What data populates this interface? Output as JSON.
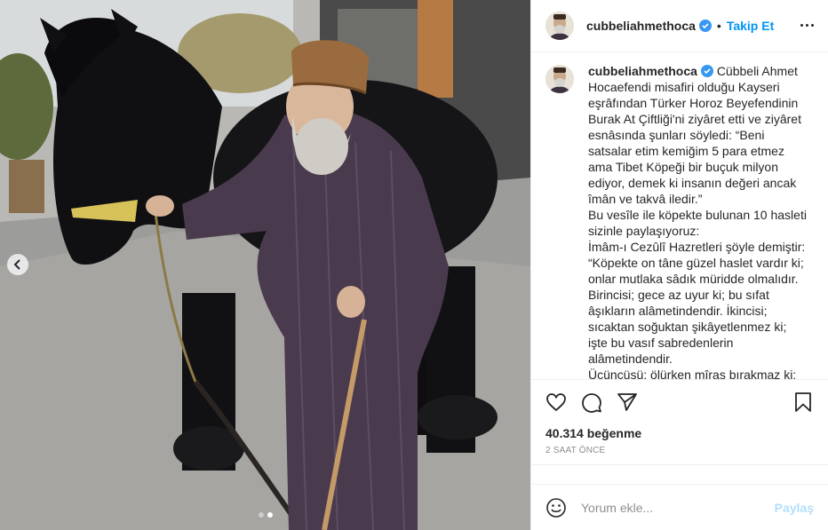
{
  "post": {
    "username": "cubbeliahmethoca",
    "separator": "•",
    "follow_label": "Takip Et",
    "caption_lines": [
      "Hocaefendi misafiri olduğu Kayseri",
      "eşrâfından Türker Horoz Beyefendinin",
      "Burak At Çiftliği'ni ziyâret etti ve ziyâret",
      "esnâsında şunları söyledi: “Beni",
      "satsalar etim kemiğim 5 para etmez",
      "ama Tibet Köpeği bir buçuk milyon",
      "ediyor, demek ki insanın değeri ancak",
      "îmân ve takvâ iledir.”",
      "Bu vesîle ile köpekte bulunan 10 hasleti",
      "sizinle paylaşıyoruz:",
      "İmâm-ı Cezûlî Hazretleri şöyle demiştir:",
      "“Köpekte on tâne güzel haslet vardır ki;",
      "onlar mutlaka sâdık müridde olmalıdır.",
      "Birincisi; gece az uyur ki; bu sıfat",
      "âşıkların alâmetindendir. İkincisi;",
      "sıcaktan soğuktan şikâyetlenmez ki;",
      "işte bu vasıf sabredenlerin",
      "alâmetindendir.",
      "Üçüncüsü; ölürken mîras bırakmaz ki;"
    ],
    "caption_first_line": "Cübbeli Ahmet",
    "likes": "40.314 beğenme",
    "timestamp": "2 SAAT ÖNCE",
    "comment_placeholder": "Yorum ekle...",
    "share_label": "Paylaş"
  },
  "icons": {
    "verified": "verified-badge-icon",
    "more": "more-options-icon",
    "prev": "chevron-left-icon",
    "like": "heart-icon",
    "comment": "comment-icon",
    "share": "paper-plane-icon",
    "save": "bookmark-icon",
    "emoji": "emoji-icon"
  },
  "colors": {
    "accent": "#0095f6",
    "verified": "#3897f0",
    "share_disabled": "#b2dffc"
  },
  "carousel": {
    "slides": 2,
    "active_index": 1
  }
}
